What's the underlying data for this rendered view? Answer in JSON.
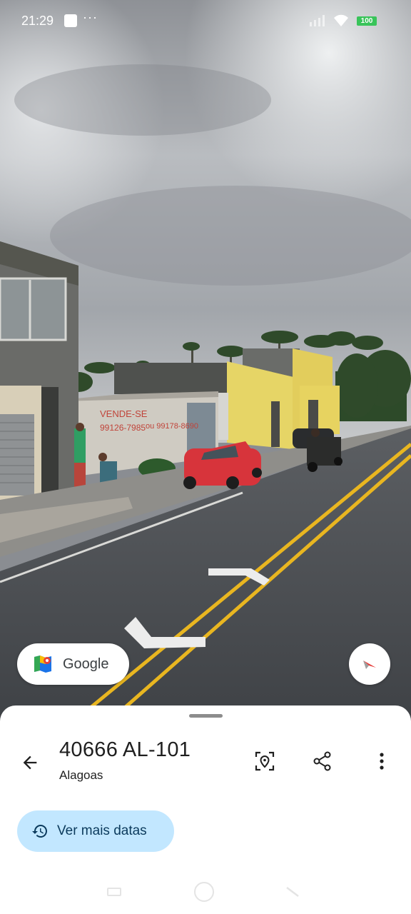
{
  "status_bar": {
    "time": "21:29",
    "dots": "···",
    "battery": "100"
  },
  "overlay": {
    "google_label": "Google",
    "scene_signs": {
      "vende_line1": "VENDE-SE",
      "vende_line2": "99126-7985",
      "vende_line3": "ou 99178-8690"
    }
  },
  "sheet": {
    "title": "40666 AL-101",
    "subtitle": "Alagoas",
    "dates_button_label": "Ver mais datas"
  },
  "colors": {
    "accent_chip": "#c2e7ff",
    "battery": "#39c45a",
    "road_line": "#e9b620"
  },
  "icons": {
    "back": "arrow-left-icon",
    "view": "location-frame-icon",
    "share": "share-icon",
    "more": "more-vertical-icon",
    "history": "history-icon",
    "compass": "compass-icon",
    "maps_logo": "google-maps-logo-icon"
  }
}
